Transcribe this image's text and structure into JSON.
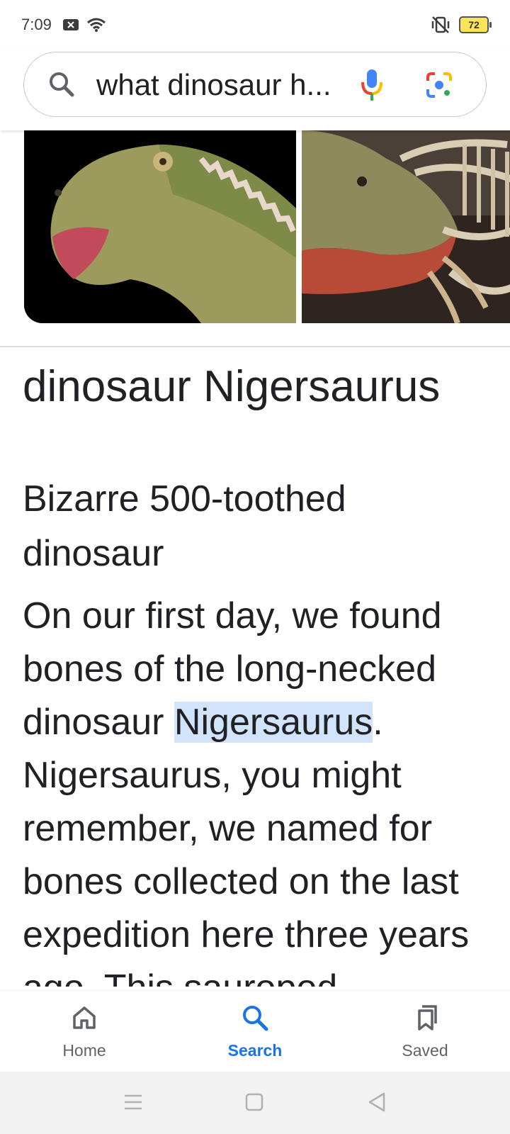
{
  "status_bar": {
    "time": "7:09",
    "battery_level": "72"
  },
  "search": {
    "query": "what dinosaur h..."
  },
  "images": [
    {
      "icon": "dinosaur-head-photo"
    },
    {
      "icon": "dinosaur-skeleton-photo"
    }
  ],
  "result": {
    "title": "dinosaur Nigersaurus",
    "subtitle": "Bizarre 500-toothed dinosaur",
    "body_before": "On our first day, we found bones of the long-necked dinosaur ",
    "body_highlight": "Nigersaurus",
    "body_after": ". Nigersaurus, you might remember, we named for bones collected on the last expedition here three years ago. This sauropod"
  },
  "bottom_nav": {
    "items": [
      {
        "label": "Home",
        "icon": "home-icon"
      },
      {
        "label": "Search",
        "icon": "search-icon"
      },
      {
        "label": "Saved",
        "icon": "bookmark-icon"
      }
    ],
    "active": "Search"
  },
  "colors": {
    "accent": "#1a73e8",
    "highlight": "#d2e3fc"
  }
}
